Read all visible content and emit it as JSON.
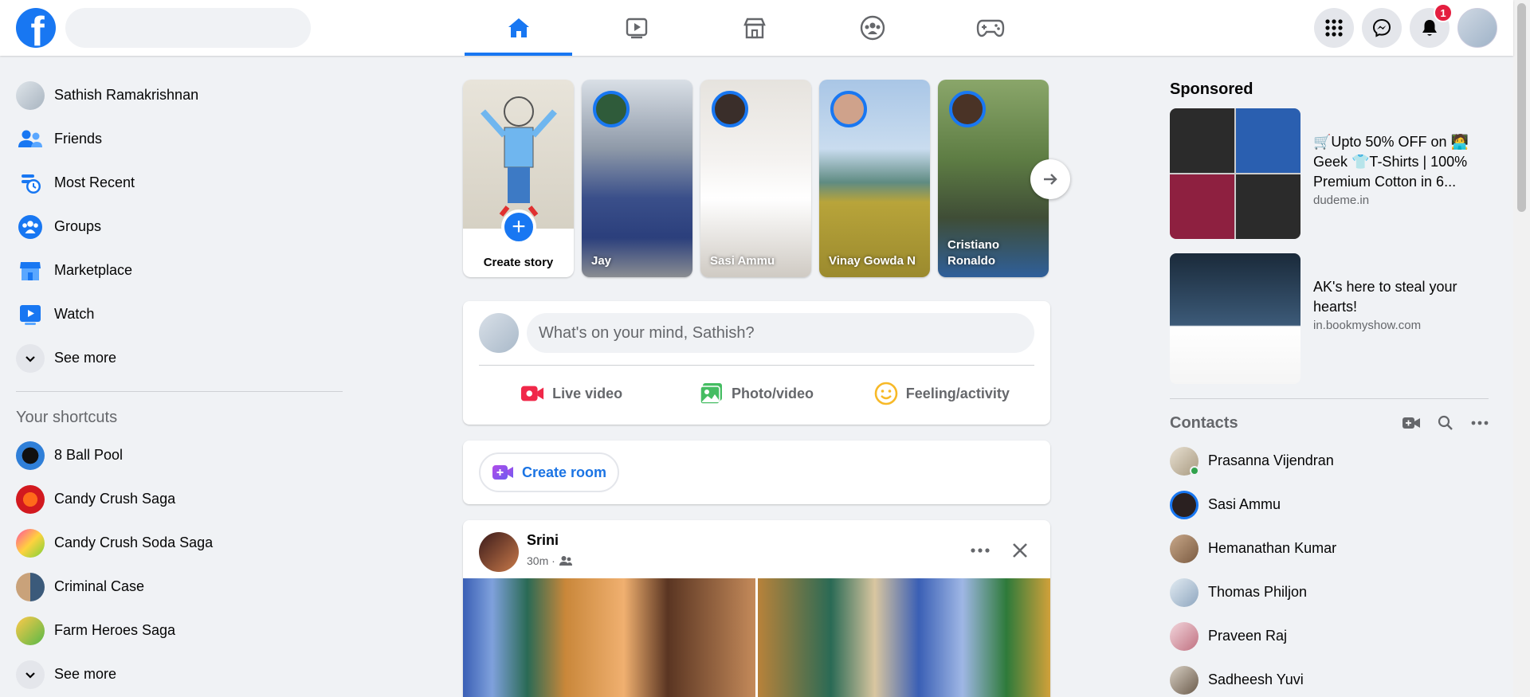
{
  "topbar": {
    "logo_letter": "f",
    "search_placeholder": "",
    "nav_tabs": [
      {
        "name": "home",
        "icon": "home-icon",
        "active": true
      },
      {
        "name": "watch",
        "icon": "video-icon",
        "active": false
      },
      {
        "name": "marketplace",
        "icon": "store-icon",
        "active": false
      },
      {
        "name": "groups",
        "icon": "groups-icon",
        "active": false
      },
      {
        "name": "gaming",
        "icon": "gamepad-icon",
        "active": false
      }
    ],
    "notification_count": "1"
  },
  "left_nav": {
    "items": [
      {
        "label": "Sathish Ramakrishnan",
        "icon": "avatar"
      },
      {
        "label": "Friends",
        "icon": "friends-icon"
      },
      {
        "label": "Most Recent",
        "icon": "clock-icon"
      },
      {
        "label": "Groups",
        "icon": "groups-icon"
      },
      {
        "label": "Marketplace",
        "icon": "store-icon"
      },
      {
        "label": "Watch",
        "icon": "video-icon"
      }
    ],
    "see_more": "See more",
    "shortcuts_title": "Your shortcuts",
    "shortcuts": [
      {
        "label": "8 Ball Pool"
      },
      {
        "label": "Candy Crush Saga"
      },
      {
        "label": "Candy Crush Soda Saga"
      },
      {
        "label": "Criminal Case"
      },
      {
        "label": "Farm Heroes Saga"
      }
    ],
    "shortcuts_see_more": "See more"
  },
  "stories": {
    "create_label": "Create story",
    "items": [
      {
        "name": "Jay"
      },
      {
        "name": "Sasi Ammu"
      },
      {
        "name": "Vinay Gowda N"
      },
      {
        "name": "Cristiano Ronaldo"
      }
    ]
  },
  "composer": {
    "placeholder": "What's on your mind, Sathish?",
    "live_label": "Live video",
    "photo_label": "Photo/video",
    "feeling_label": "Feeling/activity"
  },
  "room": {
    "label": "Create room"
  },
  "post": {
    "author": "Srini",
    "time": "30m ·"
  },
  "right": {
    "sponsored_title": "Sponsored",
    "ads": [
      {
        "headline": "🛒Upto 50% OFF on 🧑‍💻 Geek 👕T-Shirts | 100% Premium Cotton in 6...",
        "domain": "dudeme.in"
      },
      {
        "headline": "AK's here to steal your hearts!",
        "domain": "in.bookmyshow.com"
      }
    ],
    "contacts_title": "Contacts",
    "contacts": [
      {
        "name": "Prasanna Vijendran",
        "online": true
      },
      {
        "name": "Sasi Ammu",
        "online": false
      },
      {
        "name": "Hemanathan Kumar",
        "online": false
      },
      {
        "name": "Thomas Philjon",
        "online": false
      },
      {
        "name": "Praveen Raj",
        "online": false
      },
      {
        "name": "Sadheesh Yuvi",
        "online": false
      }
    ]
  },
  "colors": {
    "brand": "#1877f2",
    "background": "#f0f2f5",
    "badge": "#e41e3f",
    "live": "#f02849",
    "photo": "#45bd62",
    "feeling": "#f7b928"
  }
}
